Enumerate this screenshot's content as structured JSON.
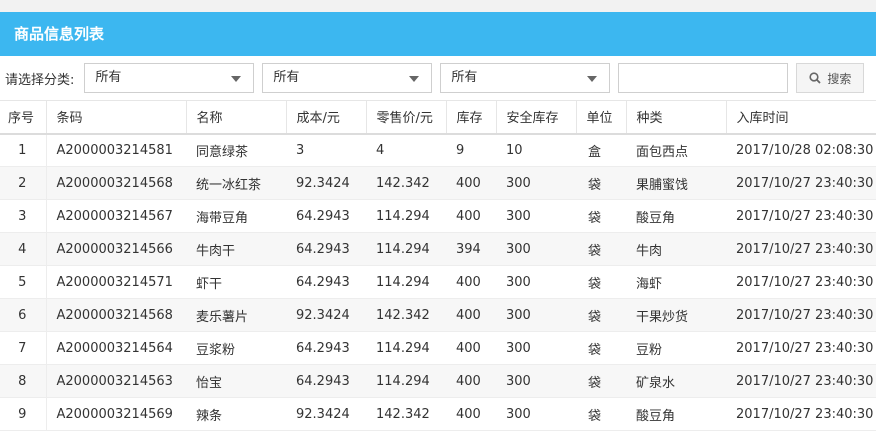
{
  "header": {
    "title": "商品信息列表"
  },
  "filter": {
    "label": "请选择分类:",
    "selects": [
      "所有",
      "所有",
      "所有"
    ],
    "search_value": "",
    "search_button": "搜索"
  },
  "table": {
    "columns": [
      "序号",
      "条码",
      "名称",
      "成本/元",
      "零售价/元",
      "库存",
      "安全库存",
      "单位",
      "种类",
      "入库时间"
    ],
    "rows": [
      [
        "1",
        "A2000003214581",
        "同意绿茶",
        "3",
        "4",
        "9",
        "10",
        "盒",
        "面包西点",
        "2017/10/28 02:08:30"
      ],
      [
        "2",
        "A2000003214568",
        "统一冰红茶",
        "92.3424",
        "142.342",
        "400",
        "300",
        "袋",
        "果脯蜜饯",
        "2017/10/27 23:40:30"
      ],
      [
        "3",
        "A2000003214567",
        "海带豆角",
        "64.2943",
        "114.294",
        "400",
        "300",
        "袋",
        "酸豆角",
        "2017/10/27 23:40:30"
      ],
      [
        "4",
        "A2000003214566",
        "牛肉干",
        "64.2943",
        "114.294",
        "394",
        "300",
        "袋",
        "牛肉",
        "2017/10/27 23:40:30"
      ],
      [
        "5",
        "A2000003214571",
        "虾干",
        "64.2943",
        "114.294",
        "400",
        "300",
        "袋",
        "海虾",
        "2017/10/27 23:40:30"
      ],
      [
        "6",
        "A2000003214568",
        "麦乐薯片",
        "92.3424",
        "142.342",
        "400",
        "300",
        "袋",
        "干果炒货",
        "2017/10/27 23:40:30"
      ],
      [
        "7",
        "A2000003214564",
        "豆浆粉",
        "64.2943",
        "114.294",
        "400",
        "300",
        "袋",
        "豆粉",
        "2017/10/27 23:40:30"
      ],
      [
        "8",
        "A2000003214563",
        "怡宝",
        "64.2943",
        "114.294",
        "400",
        "300",
        "袋",
        "矿泉水",
        "2017/10/27 23:40:30"
      ],
      [
        "9",
        "A2000003214569",
        "辣条",
        "92.3424",
        "142.342",
        "400",
        "300",
        "袋",
        "酸豆角",
        "2017/10/27 23:40:30"
      ]
    ]
  },
  "colors": {
    "header_bg": "#3cb7f0",
    "stripe": "#f7f7f7"
  },
  "icons": {
    "search": "search-icon",
    "dropdown": "chevron-down-icon"
  }
}
